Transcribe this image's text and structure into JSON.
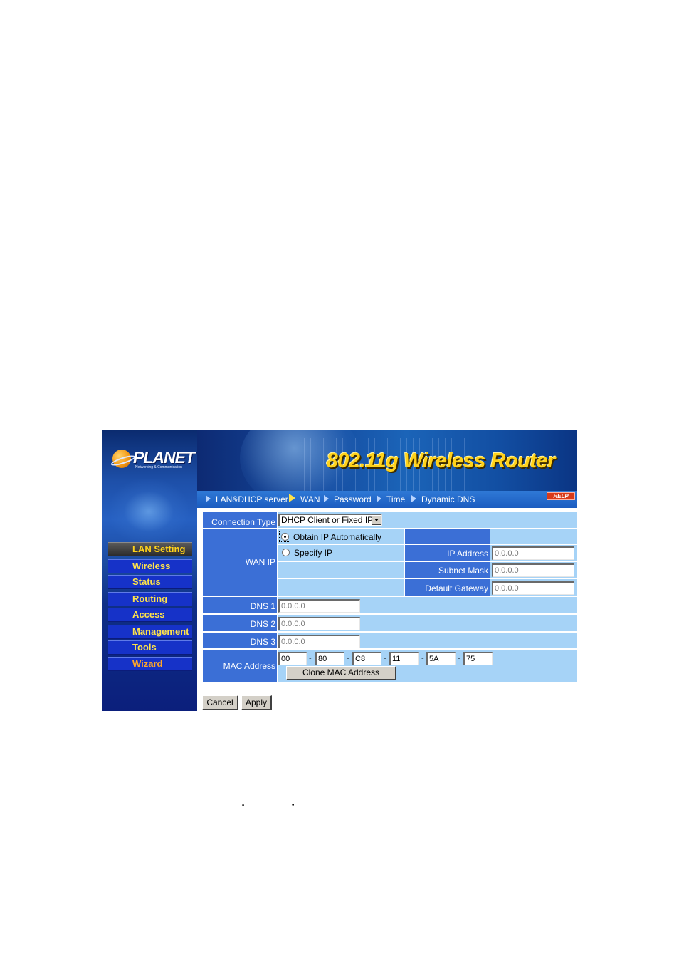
{
  "logo": {
    "name": "PLANET",
    "tagline": "Networking & Communication"
  },
  "banner": {
    "title": "802.11g Wireless Router"
  },
  "sidebar": {
    "items": [
      {
        "label": "LAN Setting",
        "active": true
      },
      {
        "label": "Wireless"
      },
      {
        "label": "Status"
      },
      {
        "label": "Routing"
      },
      {
        "label": "Access"
      },
      {
        "label": "Management"
      },
      {
        "label": "Tools"
      },
      {
        "label": "Wizard"
      }
    ]
  },
  "tabs": {
    "items": [
      {
        "label": "LAN&DHCP server"
      },
      {
        "label": "WAN",
        "active": true
      },
      {
        "label": "Password"
      },
      {
        "label": "Time"
      },
      {
        "label": "Dynamic DNS"
      }
    ],
    "help_label": "HELP"
  },
  "form": {
    "connection_type": {
      "label": "Connection Type",
      "value": "DHCP Client or Fixed IP"
    },
    "wan_ip": {
      "label": "WAN IP",
      "option_auto": "Obtain IP Automatically",
      "option_specify": "Specify IP",
      "selected": "auto",
      "ip_address": {
        "label": "IP Address",
        "value": "0.0.0.0"
      },
      "subnet_mask": {
        "label": "Subnet Mask",
        "value": "0.0.0.0"
      },
      "default_gateway": {
        "label": "Default Gateway",
        "value": "0.0.0.0"
      }
    },
    "dns1": {
      "label": "DNS 1",
      "value": "0.0.0.0"
    },
    "dns2": {
      "label": "DNS 2",
      "value": "0.0.0.0"
    },
    "dns3": {
      "label": "DNS 3",
      "value": "0.0.0.0"
    },
    "mac": {
      "label": "MAC Address",
      "octets": [
        "00",
        "80",
        "C8",
        "11",
        "5A",
        "75"
      ],
      "separator": "-",
      "clone_label": "Clone MAC Address"
    }
  },
  "actions": {
    "cancel_label": "Cancel",
    "apply_label": "Apply"
  },
  "page_note": {
    "open_quote": "“",
    "close_quote": "”"
  },
  "colors": {
    "row_dark": "#3b6fd6",
    "row_light": "#a6d3f7",
    "nav_bg": "#1632c8",
    "nav_text": "#ffe34a",
    "title": "#ffd21a"
  }
}
